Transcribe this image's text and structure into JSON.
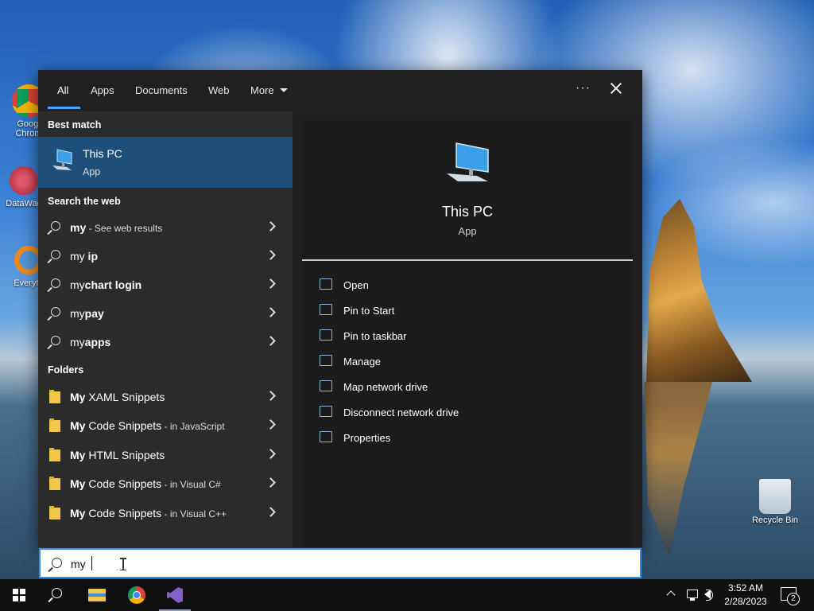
{
  "desktop": {
    "icons": [
      {
        "label": "Googl Chrom"
      },
      {
        "label": "DataWag"
      },
      {
        "label": "Everyth"
      },
      {
        "label": "Recycle Bin"
      }
    ]
  },
  "search_panel": {
    "tabs": [
      {
        "label": "All",
        "active": true
      },
      {
        "label": "Apps"
      },
      {
        "label": "Documents"
      },
      {
        "label": "Web"
      },
      {
        "label": "More"
      }
    ],
    "ellipsis": "···",
    "best_match": {
      "heading": "Best match",
      "title": "This PC",
      "subtitle": "App"
    },
    "web": {
      "heading": "Search the web",
      "items": [
        {
          "query": "my",
          "suffix": " - See web results"
        },
        {
          "query": "my",
          "rest": " ip"
        },
        {
          "query": "my",
          "rest": "chart login"
        },
        {
          "query": "my",
          "rest": "pay"
        },
        {
          "query": "my",
          "rest": "apps"
        }
      ]
    },
    "folders": {
      "heading": "Folders",
      "items": [
        {
          "match": "My",
          "rest": " XAML Snippets",
          "location": ""
        },
        {
          "match": "My",
          "rest": " Code Snippets",
          "location": " - in JavaScript"
        },
        {
          "match": "My",
          "rest": " HTML Snippets",
          "location": ""
        },
        {
          "match": "My",
          "rest": " Code Snippets",
          "location": " - in Visual C#"
        },
        {
          "match": "My",
          "rest": " Code Snippets",
          "location": " - in Visual C++"
        }
      ]
    },
    "preview": {
      "title": "This PC",
      "subtitle": "App",
      "actions": [
        {
          "label": "Open"
        },
        {
          "label": "Pin to Start"
        },
        {
          "label": "Pin to taskbar"
        },
        {
          "label": "Manage"
        },
        {
          "label": "Map network drive"
        },
        {
          "label": "Disconnect network drive"
        },
        {
          "label": "Properties"
        }
      ]
    }
  },
  "search_box": {
    "value": "my"
  },
  "taskbar": {
    "clock_time": "3:52 AM",
    "clock_date": "2/28/2023",
    "notification_count": "2"
  },
  "colors": {
    "accent": "#4aa3ff",
    "selected_row": "#1e4f7a",
    "search_border": "#3a8ee6"
  }
}
